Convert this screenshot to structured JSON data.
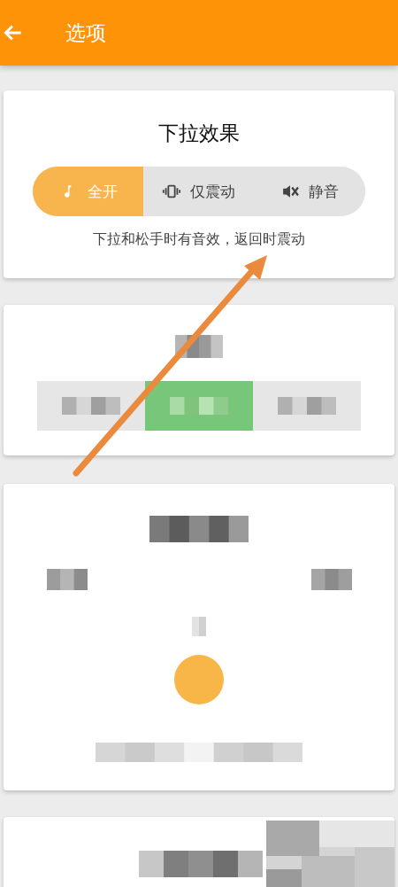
{
  "app_bar": {
    "title": "选项"
  },
  "pull_effect": {
    "title": "下拉效果",
    "options": [
      {
        "kind": "sound",
        "label": "全开",
        "selected": true
      },
      {
        "kind": "vibrate",
        "label": "仅震动",
        "selected": false
      },
      {
        "kind": "mute",
        "label": "静音",
        "selected": false
      }
    ],
    "description": "下拉和松手时有音效，返回时震动"
  },
  "second_card": {
    "segments": [
      {
        "selected": false
      },
      {
        "selected": true
      },
      {
        "selected": false
      }
    ]
  }
}
